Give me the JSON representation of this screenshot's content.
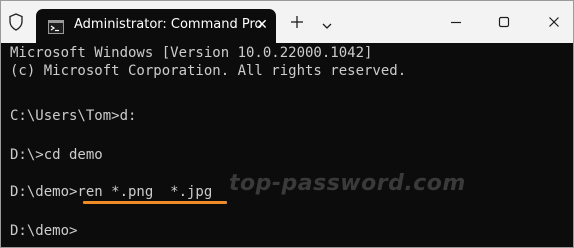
{
  "window": {
    "tab_title": "Administrator: Command Pro",
    "tab_close_glyph": "✕"
  },
  "icons": {
    "shield": "shield-icon",
    "terminal": "cmd-icon",
    "new_tab": "plus-icon",
    "dropdown": "chevron-down-icon",
    "minimize": "minimize-icon",
    "maximize": "maximize-icon",
    "close": "close-icon"
  },
  "terminal": {
    "lines": [
      "Microsoft Windows [Version 10.0.22000.1042]",
      "(c) Microsoft Corporation. All rights reserved.",
      "",
      "C:\\Users\\Tom>d:",
      "",
      "D:\\>cd demo",
      "",
      "D:\\demo>ren *.png  *.jpg",
      "",
      "D:\\demo>"
    ],
    "watermark": "top-password.com"
  },
  "colors": {
    "terminal_bg": "#0c0c0c",
    "terminal_text": "#cccccc",
    "titlebar_bg": "#f3f3f3",
    "highlight": "#f08c28"
  }
}
